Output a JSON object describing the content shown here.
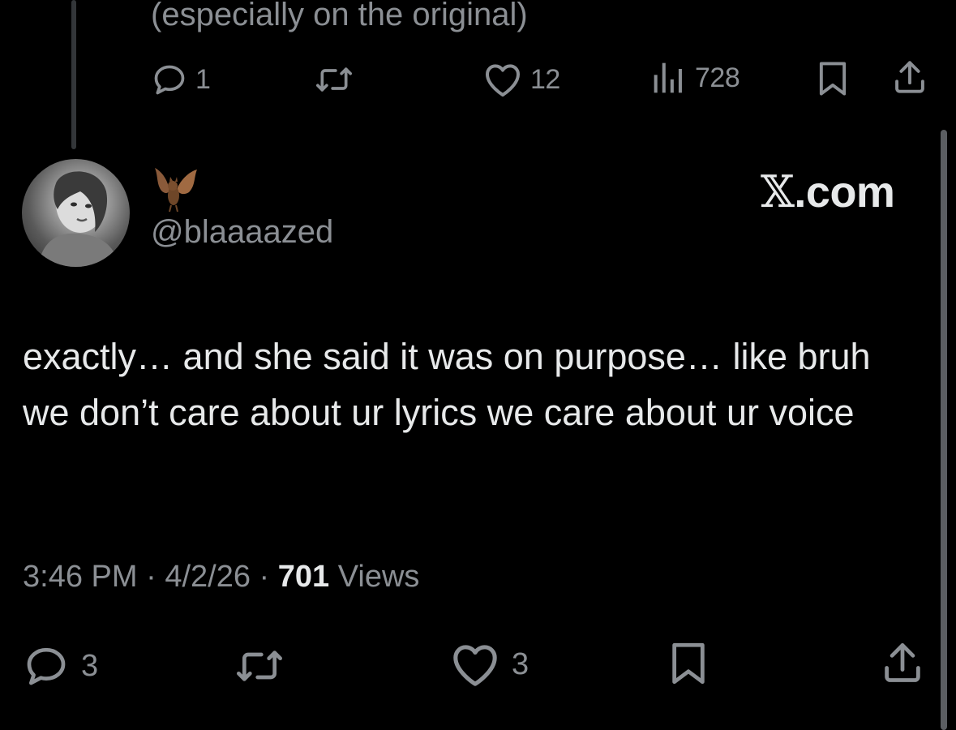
{
  "colors": {
    "background": "#000000",
    "primary_text": "#e7e9ea",
    "secondary_text": "#8b8f94",
    "thread_line": "#333639"
  },
  "previous_tweet": {
    "text_tail": "(especially on the original)",
    "actions": {
      "replies": "1",
      "retweets": "",
      "likes": "12",
      "views": "728"
    }
  },
  "tweet": {
    "display_name_icon": "bat-emoji",
    "handle": "@blaaaazed",
    "brand": {
      "x": "𝕏",
      "suffix": ".com"
    },
    "text": "exactly… and she said it was on purpose… like bruh we don’t care about ur lyrics we care about ur voice",
    "meta": {
      "time": "3:46 PM",
      "sep1": " · ",
      "date": "4/2/26",
      "sep2": " · ",
      "views_count": "701",
      "views_label": " Views"
    },
    "actions": {
      "replies": "3",
      "retweets": "",
      "likes": "3"
    }
  },
  "icons": {
    "reply": "reply-icon",
    "retweet": "retweet-icon",
    "like": "heart-icon",
    "views": "views-bar-chart-icon",
    "bookmark": "bookmark-icon",
    "share": "share-icon"
  }
}
